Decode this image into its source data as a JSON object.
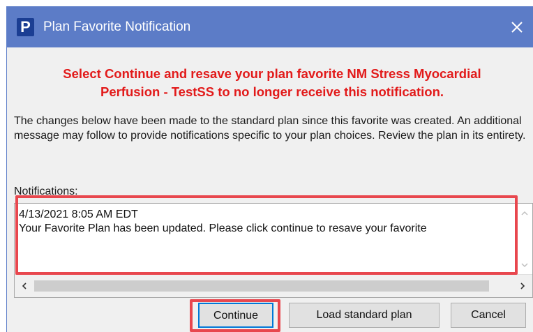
{
  "window": {
    "title": "Plan Favorite Notification",
    "app_logo_letter": "P",
    "close_glyph": "✕"
  },
  "content": {
    "warning_line1": "Select Continue and resave your plan favorite NM Stress Myocardial",
    "warning_line2": "Perfusion - TestSS to no longer receive this notification.",
    "description": "The changes below have been made to the standard plan since this favorite was created. An additional message may follow to provide notifications specific to your plan choices. Review the plan in its entirety.",
    "notifications_label": "Notifications:",
    "notification_timestamp": "4/13/2021 8:05 AM EDT",
    "notification_message": "Your Favorite Plan has been updated.  Please click continue to resave your favorite"
  },
  "buttons": {
    "continue": "Continue",
    "load_standard_plan": "Load standard plan",
    "cancel": "Cancel"
  },
  "colors": {
    "titlebar": "#5c7cc7",
    "warning_text": "#e21a1a",
    "annotation_highlight": "#e8474e",
    "focus_border": "#0078d7"
  },
  "icons": {
    "app": "planner-p-logo-icon",
    "close": "close-icon",
    "scroll_up": "chevron-up-icon",
    "scroll_down": "chevron-down-icon",
    "scroll_left": "chevron-left-icon",
    "scroll_right": "chevron-right-icon"
  }
}
